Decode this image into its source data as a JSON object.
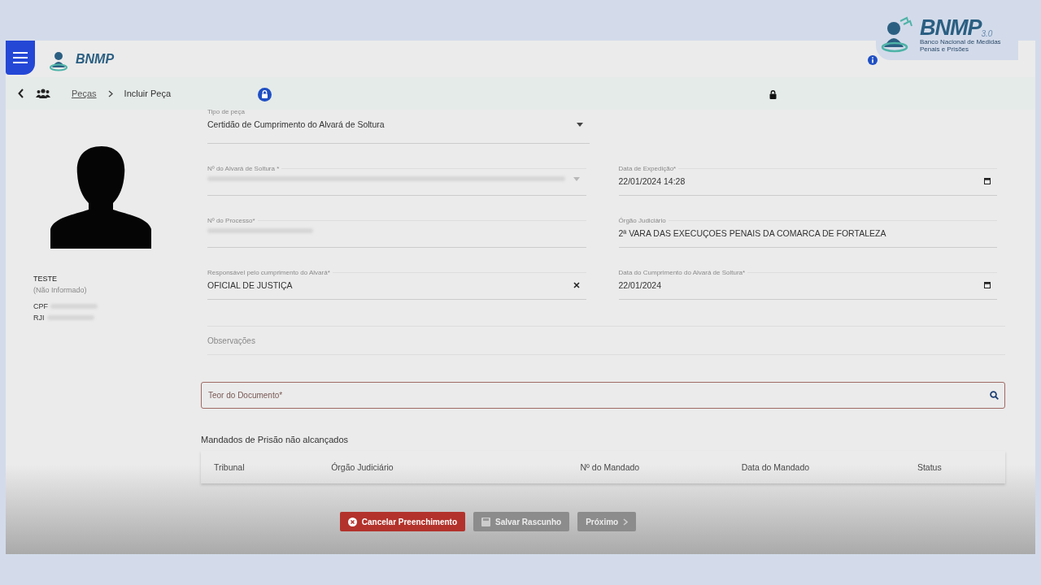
{
  "header": {
    "logo_small": "BNMP",
    "logo": {
      "name": "BNMP",
      "version": "3.0",
      "subtitle": "Banco Nacional de Medidas Penais e Prisões"
    }
  },
  "breadcrumb": [
    {
      "label": "Peças",
      "link": true
    },
    {
      "label": "Incluir Peça",
      "link": false
    }
  ],
  "person": {
    "name": "TESTE",
    "subtitle": "(Não Informado)",
    "ids": [
      {
        "label": "CPF"
      },
      {
        "label": "RJI"
      }
    ]
  },
  "fields": [
    {
      "label": "Tipo de peça",
      "value": "Certidão de Cumprimento do Alvará de Soltura",
      "kind": "select",
      "blurred": false
    },
    {
      "label": "Nº do Alvará de Soltura *",
      "kind": "select",
      "blurred": true
    },
    {
      "label": "Data de Expedição*",
      "value": "22/01/2024 14:28",
      "kind": "date",
      "blurred": false
    },
    {
      "label": "Nº do Processo*",
      "kind": "text",
      "blurred": true
    },
    {
      "label": "Órgão Judiciário",
      "value": "2ª VARA DAS EXECUÇOES PENAIS DA COMARCA DE FORTALEZA",
      "kind": "text",
      "blurred": false
    },
    {
      "label": "Responsável pelo cumprimento do Alvará*",
      "value": "OFICIAL DE JUSTIÇA",
      "kind": "clear",
      "blurred": false
    },
    {
      "label": "Data do Cumprimento do Alvará de Soltura*",
      "value": "22/01/2024",
      "kind": "date",
      "blurred": false
    }
  ],
  "observations": {
    "placeholder": "Observações"
  },
  "document": {
    "placeholder": "Teor do Documento*"
  },
  "warrants": {
    "title": "Mandados de Prisão não alcançados",
    "columns": [
      "Tribunal",
      "Órgão Judiciário",
      "Nº do Mandado",
      "Data do Mandado",
      "Status"
    ]
  },
  "buttons": [
    {
      "label": "Cancelar Preenchimento",
      "kind": "cancel",
      "disabled": false
    },
    {
      "label": "Salvar Rascunho",
      "kind": "save",
      "disabled": true
    },
    {
      "label": "Próximo",
      "kind": "next",
      "disabled": true
    }
  ]
}
